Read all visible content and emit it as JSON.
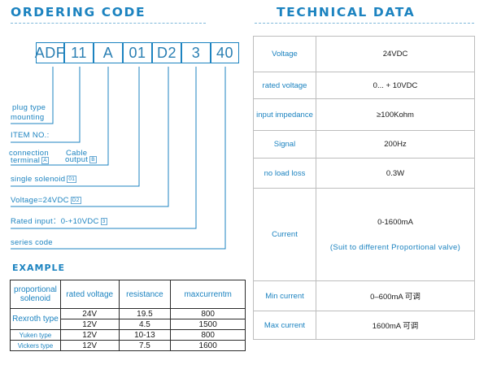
{
  "ordering": {
    "title": "ORDERING CODE",
    "codes": [
      "ADF",
      "11",
      "A",
      "01",
      "D2",
      "3",
      "40"
    ],
    "labels": {
      "plug_type": "plug type",
      "mounting": "mounting",
      "item_no": "ITEM NO.:",
      "connection": "connection",
      "terminal": "terminal",
      "tag_a": "A",
      "cable": "Cable",
      "output": "output",
      "tag_b": "B",
      "single_solenoid": "single solenoid",
      "tag_01": "01",
      "voltage": "Voltage=24VDC",
      "tag_d2": "D2",
      "rated_input": "Rated input：0-+10VDC",
      "tag_3": "3",
      "series_code": "series code"
    }
  },
  "example": {
    "title": "EXAMPLE",
    "headers": [
      "proportional solenoid",
      "rated voltage",
      "resistance",
      "maxcurrentm"
    ],
    "rows": [
      {
        "name": "Rexroth type",
        "voltage": "24V",
        "resistance": "19.5",
        "current": "800"
      },
      {
        "name": "",
        "voltage": "12V",
        "resistance": "4.5",
        "current": "1500"
      },
      {
        "name": "Yuken type",
        "voltage": "12V",
        "resistance": "10-13",
        "current": "800"
      },
      {
        "name": "Vickers type",
        "voltage": "12V",
        "resistance": "7.5",
        "current": "1600"
      }
    ]
  },
  "technical": {
    "title": "TECHNICAL DATA",
    "rows": [
      {
        "name": "Voltage",
        "value": "24VDC"
      },
      {
        "name": "rated voltage",
        "value": "0... + 10VDC"
      },
      {
        "name": "input impedance",
        "value": "≥100Kohm"
      },
      {
        "name": "Signal",
        "value": "200Hz"
      },
      {
        "name": "no load loss",
        "value": "0.3W"
      },
      {
        "name": "Current",
        "value": "0-1600mA",
        "note": "(Suit to different Proportional valve)"
      },
      {
        "name": "Min current",
        "value": "0–600mA 可调"
      },
      {
        "name": "Max current",
        "value": "1600mA 可调"
      }
    ]
  },
  "colors": {
    "accent": "#1c83c0",
    "text": "#1a1a1a",
    "border": "#bdbdbd"
  }
}
